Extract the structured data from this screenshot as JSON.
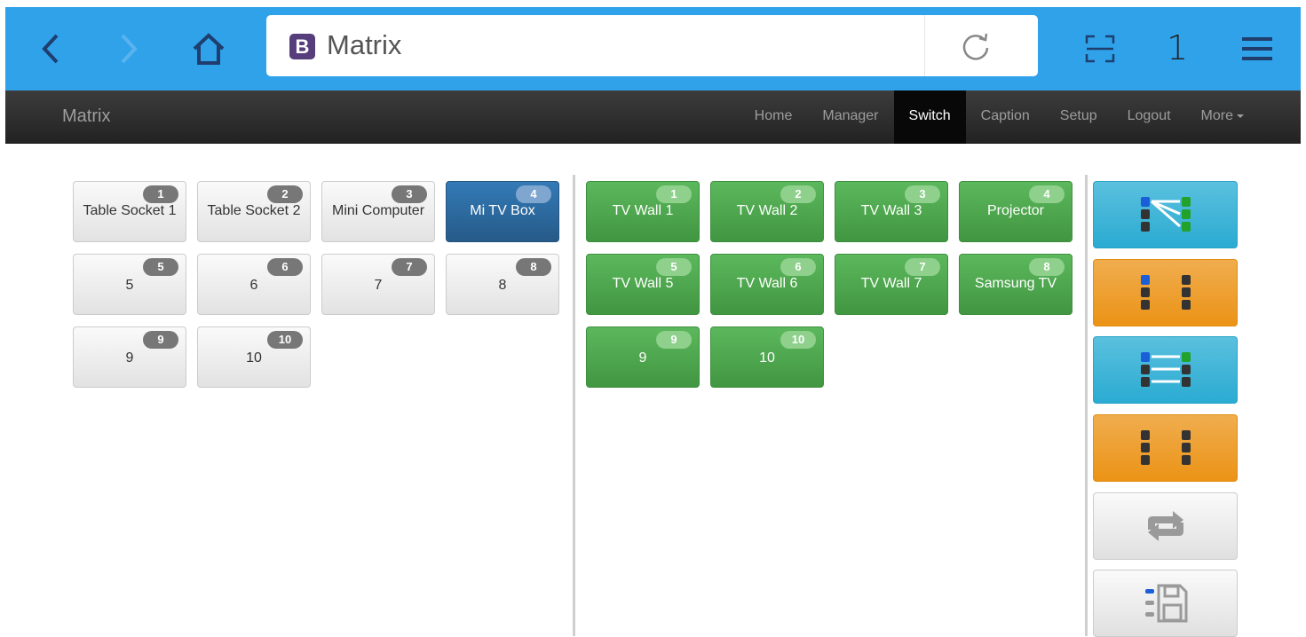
{
  "browser": {
    "url_brand_letter": "B",
    "url_title": "Matrix",
    "tab_count": "1",
    "icons": [
      "back-icon",
      "forward-icon",
      "home-icon",
      "reload-icon",
      "scan-icon",
      "menu-icon"
    ]
  },
  "navbar": {
    "brand": "Matrix",
    "links": [
      {
        "label": "Home"
      },
      {
        "label": "Manager"
      },
      {
        "label": "Switch",
        "active": true
      },
      {
        "label": "Caption"
      },
      {
        "label": "Setup"
      },
      {
        "label": "Logout"
      },
      {
        "label": "More",
        "dropdown": true
      }
    ]
  },
  "inputs": [
    {
      "badge": "1",
      "label": "Table Socket 1"
    },
    {
      "badge": "2",
      "label": "Table Socket 2"
    },
    {
      "badge": "3",
      "label": "Mini Computer"
    },
    {
      "badge": "4",
      "label": "Mi TV Box",
      "selected": true
    },
    {
      "badge": "5",
      "label": "5"
    },
    {
      "badge": "6",
      "label": "6"
    },
    {
      "badge": "7",
      "label": "7"
    },
    {
      "badge": "8",
      "label": "8"
    },
    {
      "badge": "9",
      "label": "9"
    },
    {
      "badge": "10",
      "label": "10"
    }
  ],
  "outputs": [
    {
      "badge": "1",
      "label": "TV Wall 1"
    },
    {
      "badge": "2",
      "label": "TV Wall 2"
    },
    {
      "badge": "3",
      "label": "TV Wall 3"
    },
    {
      "badge": "4",
      "label": "Projector"
    },
    {
      "badge": "5",
      "label": "TV Wall 5"
    },
    {
      "badge": "6",
      "label": "TV Wall 6"
    },
    {
      "badge": "7",
      "label": "TV Wall 7"
    },
    {
      "badge": "8",
      "label": "Samsung TV"
    },
    {
      "badge": "9",
      "label": "9"
    },
    {
      "badge": "10",
      "label": "10"
    }
  ],
  "side_buttons": [
    {
      "icon": "one-to-all-icon",
      "style": "info"
    },
    {
      "icon": "disconnect-one-icon",
      "style": "warn"
    },
    {
      "icon": "one-to-one-icon",
      "style": "info"
    },
    {
      "icon": "disconnect-all-icon",
      "style": "warn"
    },
    {
      "icon": "refresh-icon",
      "style": "default"
    },
    {
      "icon": "save-scene-icon",
      "style": "default"
    }
  ],
  "colors": {
    "browser_bar": "#2fa2ea",
    "navbar": "#222222",
    "input_selected": "#265a88",
    "output": "#5cb85c",
    "info": "#5bc0de",
    "warning": "#f0ad4e"
  }
}
